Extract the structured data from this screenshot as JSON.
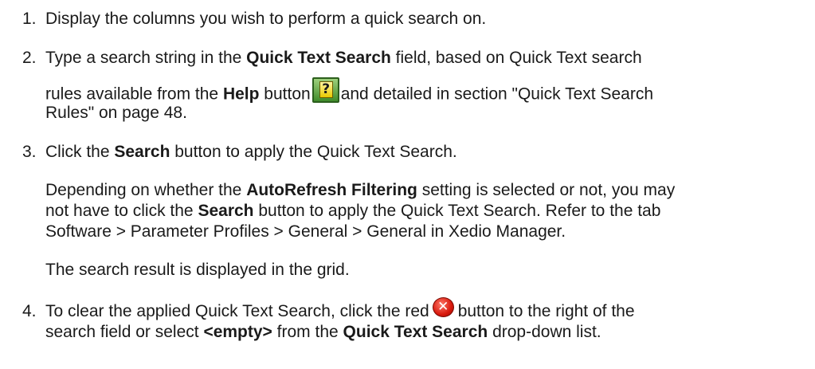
{
  "steps": [
    {
      "number": "1.",
      "text": "Display the columns you wish to perform a quick search on."
    },
    {
      "number": "2.",
      "line1": {
        "a": "Type a search string in the ",
        "b": "Quick Text Search",
        "c": " field, based on Quick Text search"
      },
      "line2": {
        "a": "rules available from the ",
        "b": "Help",
        "c": " button",
        "d": "and detailed in section \"Quick Text Search"
      },
      "line3": "Rules\" on page 48."
    },
    {
      "number": "3.",
      "line1": {
        "a": "Click the ",
        "b": "Search",
        "c": " button to apply the Quick Text Search."
      },
      "para1_line1": {
        "a": "Depending on whether the ",
        "b": "AutoRefresh Filtering",
        "c": " setting is selected or not, you may"
      },
      "para1_line2": {
        "a": "not have to click the ",
        "b": "Search",
        "c": " button to apply the Quick Text Search. Refer to the tab"
      },
      "para1_line3": "Software > Parameter Profiles > General > General in Xedio Manager.",
      "para2": "The search result is displayed in the grid."
    },
    {
      "number": "4.",
      "line1": {
        "a": "To clear the applied Quick Text Search, click the red",
        "b": "button to the right of the"
      },
      "line2": {
        "a": "search field or select ",
        "b": "<empty>",
        "c": " from the ",
        "d": "Quick Text Search",
        "e": " drop-down list."
      }
    }
  ],
  "icons": {
    "help": "help-question-icon",
    "help_glyph": "?",
    "clear": "clear-red-x-icon",
    "clear_glyph": "✕"
  }
}
